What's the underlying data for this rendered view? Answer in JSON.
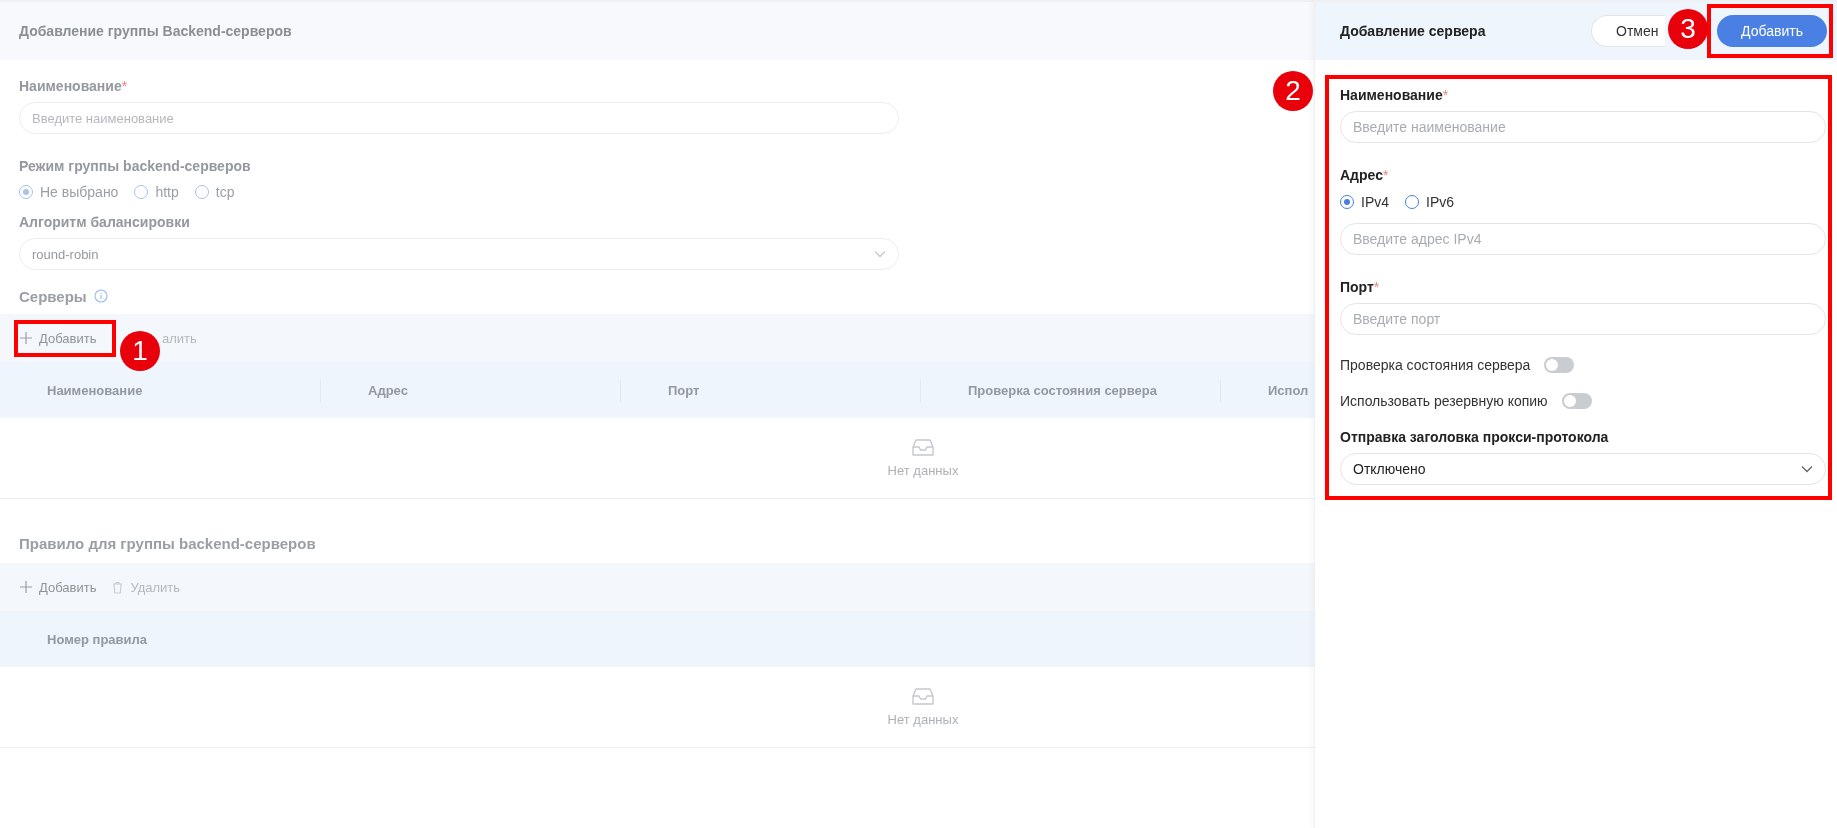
{
  "group_form": {
    "title": "Добавление группы Backend-серверов",
    "name_field": {
      "label": "Наименование",
      "required_mark": "*",
      "placeholder": "Введите наименование"
    },
    "mode": {
      "label": "Режим группы backend-серверов",
      "options": [
        {
          "label": "Не выбрано",
          "selected": true
        },
        {
          "label": "http",
          "selected": false
        },
        {
          "label": "tcp",
          "selected": false
        }
      ]
    },
    "algorithm": {
      "label": "Алгоритм балансировки",
      "value": "round-robin"
    },
    "servers": {
      "title": "Серверы",
      "toolbar": {
        "add": "Добавить",
        "delete": "алить"
      },
      "columns": [
        "Наименование",
        "Адрес",
        "Порт",
        "Проверка состояния сервера",
        "Испол"
      ],
      "empty": "Нет данных"
    },
    "rules": {
      "title": "Правило для группы backend-серверов",
      "toolbar": {
        "add": "Добавить",
        "delete": "Удалить"
      },
      "columns": [
        "Номер правила"
      ],
      "empty": "Нет данных"
    }
  },
  "drawer": {
    "title": "Добавление сервера",
    "cancel": "Отмен",
    "submit": "Добавить",
    "name_field": {
      "label": "Наименование",
      "required_mark": "*",
      "placeholder": "Введите наименование"
    },
    "address": {
      "label": "Адрес",
      "required_mark": "*",
      "options": [
        {
          "label": "IPv4",
          "selected": true
        },
        {
          "label": "IPv6",
          "selected": false
        }
      ],
      "placeholder": "Введите адрес IPv4"
    },
    "port": {
      "label": "Порт",
      "required_mark": "*",
      "placeholder": "Введите порт"
    },
    "toggles": [
      {
        "label": "Проверка состояния сервера",
        "on": false
      },
      {
        "label": "Использовать резервную копию",
        "on": false
      }
    ],
    "proxy": {
      "label": "Отправка заголовка прокси-протокола",
      "value": "Отключено"
    }
  },
  "annotations": [
    {
      "number": "1"
    },
    {
      "number": "2"
    },
    {
      "number": "3"
    }
  ]
}
